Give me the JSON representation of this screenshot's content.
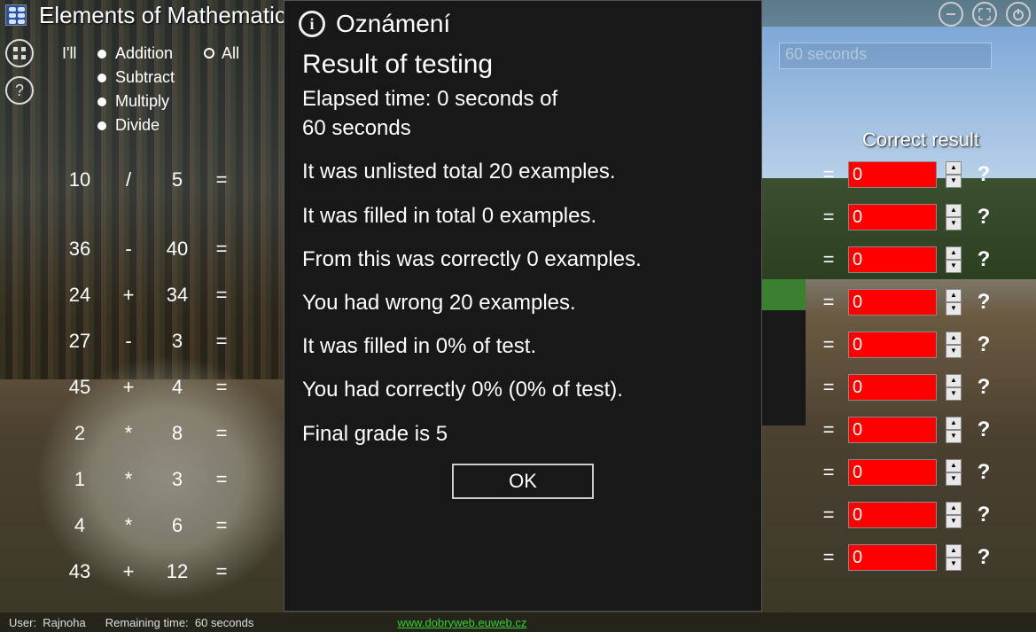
{
  "app": {
    "title": "Elements of Mathematics"
  },
  "window_controls": {
    "minimize": "—",
    "fullscreen": "⛶",
    "power": "⏻"
  },
  "side": {
    "menu": "⊞",
    "help": "?"
  },
  "practice_label": "I'll",
  "ops": {
    "addition": "Addition",
    "subtract": "Subtract",
    "multiply": "Multiply",
    "divide": "Divide",
    "all": "All"
  },
  "timer_display": "60 seconds",
  "correct_header": "Correct result",
  "rows_left": [
    {
      "a": "10",
      "op": "/",
      "b": "5",
      "eq": "="
    },
    {
      "a": "",
      "op": "",
      "b": "",
      "eq": ""
    },
    {
      "a": "36",
      "op": "-",
      "b": "40",
      "eq": "="
    },
    {
      "a": "24",
      "op": "+",
      "b": "34",
      "eq": "="
    },
    {
      "a": "27",
      "op": "-",
      "b": "3",
      "eq": "="
    },
    {
      "a": "45",
      "op": "+",
      "b": "4",
      "eq": "="
    },
    {
      "a": "2",
      "op": "*",
      "b": "8",
      "eq": "="
    },
    {
      "a": "1",
      "op": "*",
      "b": "3",
      "eq": "="
    },
    {
      "a": "4",
      "op": "*",
      "b": "6",
      "eq": "="
    },
    {
      "a": "43",
      "op": "+",
      "b": "12",
      "eq": "="
    }
  ],
  "rows_right": [
    {
      "eq": "=",
      "val": "0",
      "q": "?"
    },
    {
      "eq": "=",
      "val": "0",
      "q": "?"
    },
    {
      "eq": "=",
      "val": "0",
      "q": "?"
    },
    {
      "eq": "=",
      "val": "0",
      "q": "?"
    },
    {
      "eq": "=",
      "val": "0",
      "q": "?"
    },
    {
      "eq": "=",
      "val": "0",
      "q": "?"
    },
    {
      "eq": "=",
      "val": "0",
      "q": "?"
    },
    {
      "eq": "=",
      "val": "0",
      "q": "?"
    },
    {
      "eq": "=",
      "val": "0",
      "q": "?"
    },
    {
      "eq": "=",
      "val": "0",
      "q": "?"
    }
  ],
  "modal": {
    "header": "Oznámení",
    "heading": "Result of testing",
    "elapsed_line1": "Elapsed time: 0 seconds of",
    "elapsed_line2": " 60 seconds",
    "line_unlisted": "It was unlisted total 20 examples.",
    "line_filled": "It was filled in total 0 examples.",
    "line_correct": "From this was correctly 0 examples.",
    "line_wrong": "You had wrong 20 examples.",
    "line_percent": "It was filled in 0% of test.",
    "line_correct_pct": "You had correctly 0% (0% of test).",
    "line_grade": "Final grade is 5",
    "ok": "OK"
  },
  "status": {
    "user_label": "User:",
    "user": "Rajnoha",
    "remaining_label": "Remaining time:",
    "remaining": "60 seconds",
    "link": "www.dobryweb.euweb.cz"
  }
}
